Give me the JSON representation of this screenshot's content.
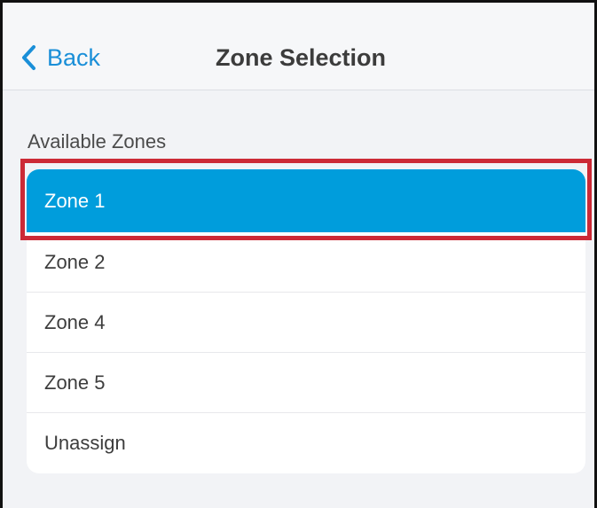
{
  "nav": {
    "back_label": "Back",
    "title": "Zone Selection"
  },
  "section": {
    "label": "Available Zones"
  },
  "zones": [
    {
      "label": "Zone 1",
      "selected": true
    },
    {
      "label": "Zone 2",
      "selected": false
    },
    {
      "label": "Zone 4",
      "selected": false
    },
    {
      "label": "Zone 5",
      "selected": false
    },
    {
      "label": "Unassign",
      "selected": false
    }
  ],
  "colors": {
    "accent": "#1a8fd8",
    "selected_row": "#009ddc",
    "highlight_border": "#cc2a36",
    "background": "#f2f3f6"
  },
  "icons": {
    "back": "chevron-left-icon"
  }
}
